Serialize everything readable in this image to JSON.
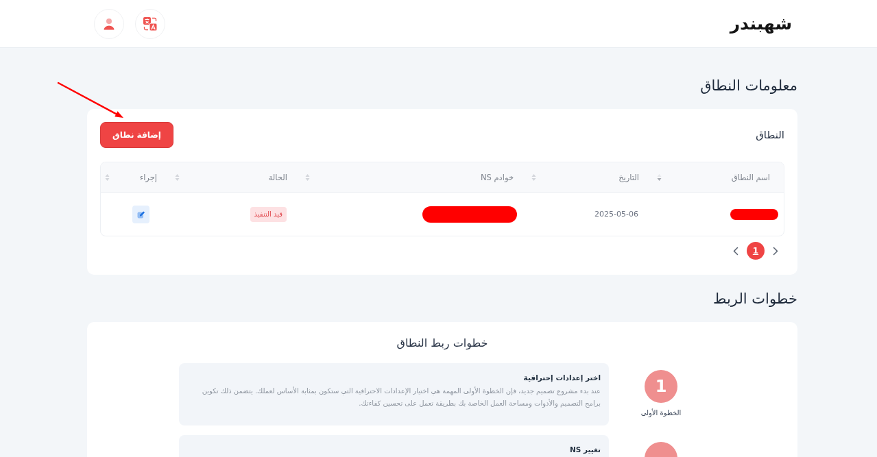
{
  "header": {
    "logo": "شهبندر"
  },
  "domain_info": {
    "title": "معلومات النطاق",
    "card_label": "النطاق",
    "add_button": "إضافة نطاق",
    "table": {
      "columns": [
        {
          "label": "اسم النطاق",
          "sorted": true
        },
        {
          "label": "التاريخ",
          "sorted": false
        },
        {
          "label": "خوادم NS",
          "sorted": false
        },
        {
          "label": "الحالة",
          "sorted": false
        },
        {
          "label": "إجراء",
          "sorted": false
        }
      ],
      "rows": [
        {
          "domain": {
            "redacted": true
          },
          "date": "2025-05-06",
          "ns_servers": {
            "redacted": true
          },
          "status": {
            "label": "قيد التنفيذ",
            "kind": "pending"
          }
        }
      ]
    },
    "pagination": {
      "pages": [
        {
          "label": "1",
          "selected": true
        }
      ]
    }
  },
  "linking": {
    "title": "خطوات الربط",
    "card_title": "خطوات ربط النطاق",
    "steps": [
      {
        "number": "1",
        "label": "الخطوة الأولى",
        "title": "اختر إعدادات إحترافية",
        "description": "عند بدء مشروع تصميم جديد، فإن الخطوة الأولى المهمة هي اختيار الإعدادات الاحترافية التي ستكون بمثابة الأساس لعملك. يتضمن ذلك تكوين برامج التصميم والأدوات ومساحة العمل الخاصة بك بطريقة تعمل على تحسين كفاءتك."
      },
      {
        "title": "تغيير NS"
      }
    ]
  },
  "annotations": [
    {
      "kind": "arrow"
    }
  ]
}
